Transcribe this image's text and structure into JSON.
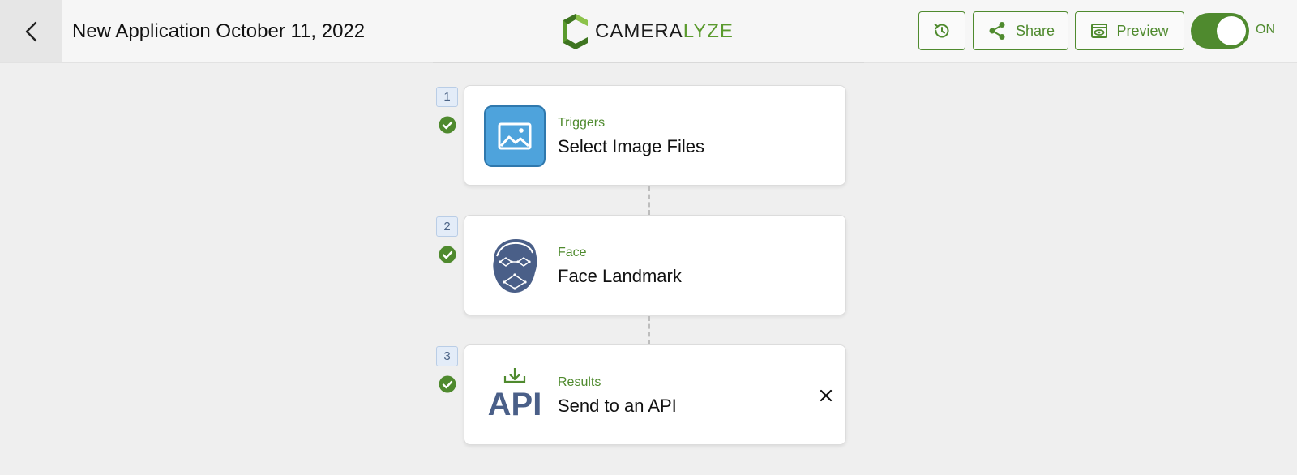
{
  "header": {
    "title": "New Application October 11, 2022",
    "logo": {
      "text_main": "CAMERA",
      "text_accent": "LYZE",
      "icon": "cameralyze-logo-icon"
    },
    "buttons": {
      "history": {
        "icon": "history-icon"
      },
      "share": {
        "label": "Share",
        "icon": "share-icon"
      },
      "preview": {
        "label": "Preview",
        "icon": "eye-icon"
      }
    },
    "toggle": {
      "state": "on",
      "label": "ON"
    },
    "back_icon": "chevron-left-icon"
  },
  "workflow": {
    "steps": [
      {
        "number": "1",
        "category": "Triggers",
        "title": "Select Image Files",
        "icon": "image-icon",
        "completed": true
      },
      {
        "number": "2",
        "category": "Face",
        "title": "Face Landmark",
        "icon": "face-landmark-icon",
        "completed": true
      },
      {
        "number": "3",
        "category": "Results",
        "title": "Send to an API",
        "icon": "api-download-icon",
        "completed": true,
        "removable": true
      }
    ]
  },
  "colors": {
    "accent": "#4f8a2e",
    "background": "#efefef",
    "step_badge": "#e3ecf8",
    "image_tile": "#4ea3dc",
    "icon_navy": "#4a5f88"
  }
}
